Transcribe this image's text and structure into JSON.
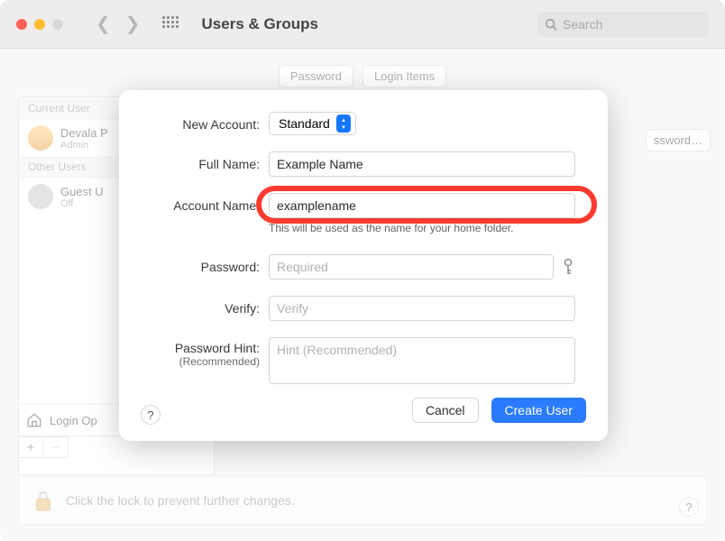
{
  "window": {
    "title": "Users & Groups",
    "search_placeholder": "Search"
  },
  "tabs": {
    "password": "Password",
    "login_items": "Login Items"
  },
  "sidebar": {
    "current_header": "Current User",
    "other_header": "Other Users",
    "current": {
      "name": "Devala P",
      "role": "Admin"
    },
    "guest": {
      "name": "Guest U",
      "sub": "Off"
    },
    "login_options": "Login Op"
  },
  "buttons": {
    "change_password": "ssword…",
    "cancel": "Cancel",
    "create_user": "Create User"
  },
  "lock_text": "Click the lock to prevent further changes.",
  "sheet": {
    "new_account_label": "New Account:",
    "new_account_value": "Standard",
    "full_name_label": "Full Name:",
    "full_name_value": "Example Name",
    "account_name_label": "Account Name:",
    "account_name_value": "examplename",
    "account_name_hint": "This will be used as the name for your home folder.",
    "password_label": "Password:",
    "password_placeholder": "Required",
    "verify_label": "Verify:",
    "verify_placeholder": "Verify",
    "hint_label": "Password Hint:",
    "hint_sub": "(Recommended)",
    "hint_placeholder": "Hint (Recommended)"
  }
}
